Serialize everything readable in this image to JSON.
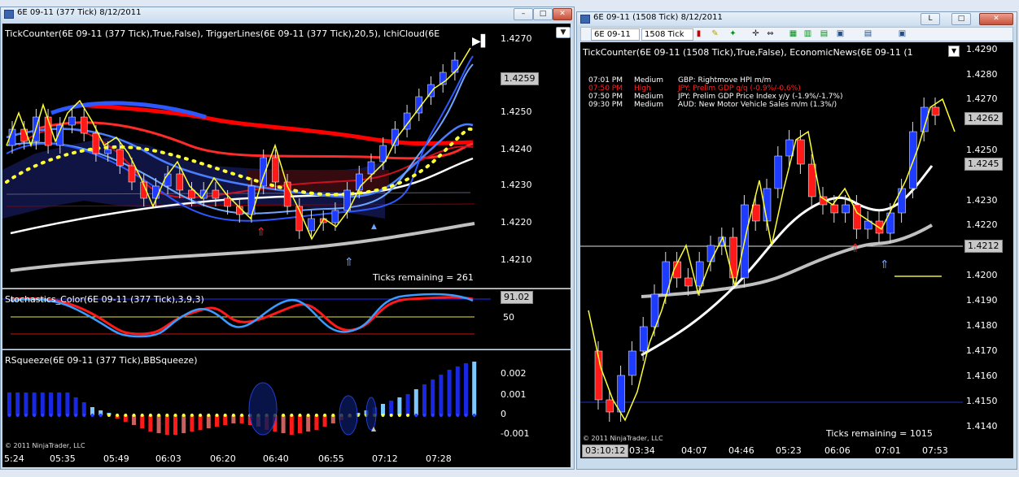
{
  "left_window": {
    "title": "6E 09-11 (377 Tick)  8/12/2011",
    "min_button": "–",
    "max_button": "□",
    "close_button": "✕",
    "main_label": "TickCounter(6E 09-11 (377 Tick),True,False), TriggerLines(6E 09-11 (377 Tick),20,5), IchiCloud(6E",
    "price_axis": [
      "1.4270",
      "1.4259",
      "1.4250",
      "1.4240",
      "1.4230",
      "1.4220",
      "1.4210"
    ],
    "current_price": "1.4259",
    "ticks_remaining": "Ticks remaining = 261",
    "stoch_label": "Stochastics_Color(6E 09-11 (377 Tick),3,9,3)",
    "stoch_value": "91.02",
    "stoch_level": "50",
    "squeeze_label": "RSqueeze(6E 09-11 (377 Tick),BBSqueeze)",
    "squeeze_axis": [
      "0.002",
      "0.001",
      "0",
      "-0.001"
    ],
    "copyright": "© 2011 NinjaTrader, LLC",
    "time_axis": [
      "5:24",
      "05:35",
      "05:49",
      "06:03",
      "06:20",
      "06:40",
      "06:55",
      "07:12",
      "07:28"
    ]
  },
  "right_window": {
    "title": "6E 09-11 (1508 Tick)  8/12/2011",
    "min_button": "L",
    "max_button": "□",
    "close_button": "✕",
    "instrument": "6E 09-11",
    "interval": "1508 Tick",
    "main_label": "TickCounter(6E 09-11 (1508 Tick),True,False), EconomicNews(6E 09-11 (1",
    "news": [
      {
        "time": "07:01 PM",
        "impact": "Medium",
        "event": "GBP: Rightmove HPI m/m",
        "color": "#ffffff"
      },
      {
        "time": "07:50 PM",
        "impact": "High",
        "event": "JPY: Prelim GDP q/q (-0.9%/-0.6%)",
        "color": "#ff2020"
      },
      {
        "time": "07:50 PM",
        "impact": "Medium",
        "event": "JPY: Prelim GDP Price Index y/y (-1.9%/-1.7%)",
        "color": "#ffffff"
      },
      {
        "time": "09:30 PM",
        "impact": "Medium",
        "event": "AUD: New Motor Vehicle Sales m/m (1.3%/)",
        "color": "#ffffff"
      }
    ],
    "price_axis": [
      "1.4290",
      "1.4280",
      "1.4270",
      "1.4262",
      "1.4250",
      "1.4245",
      "1.4230",
      "1.4220",
      "1.4212",
      "1.4200",
      "1.4190",
      "1.4180",
      "1.4170",
      "1.4160",
      "1.4150",
      "1.4140"
    ],
    "price_box_1": "1.4262",
    "price_box_2": "1.4245",
    "price_box_3": "1.4212",
    "ticks_remaining": "Ticks remaining = 1015",
    "copyright": "© 2011 NinjaTrader, LLC",
    "time_axis": [
      "03:10:12",
      "03:34",
      "04:07",
      "04:46",
      "05:23",
      "06:06",
      "07:01",
      "07:53"
    ]
  },
  "colors": {
    "bull_candle": "#1e3cff",
    "bear_candle": "#ff1a1a",
    "trigger_line": "#ffff33",
    "ma_red": "#ff0000",
    "ma_blue": "#3a5cff",
    "ma_white": "#ffffff",
    "ma_gray": "#c0c0c0"
  }
}
